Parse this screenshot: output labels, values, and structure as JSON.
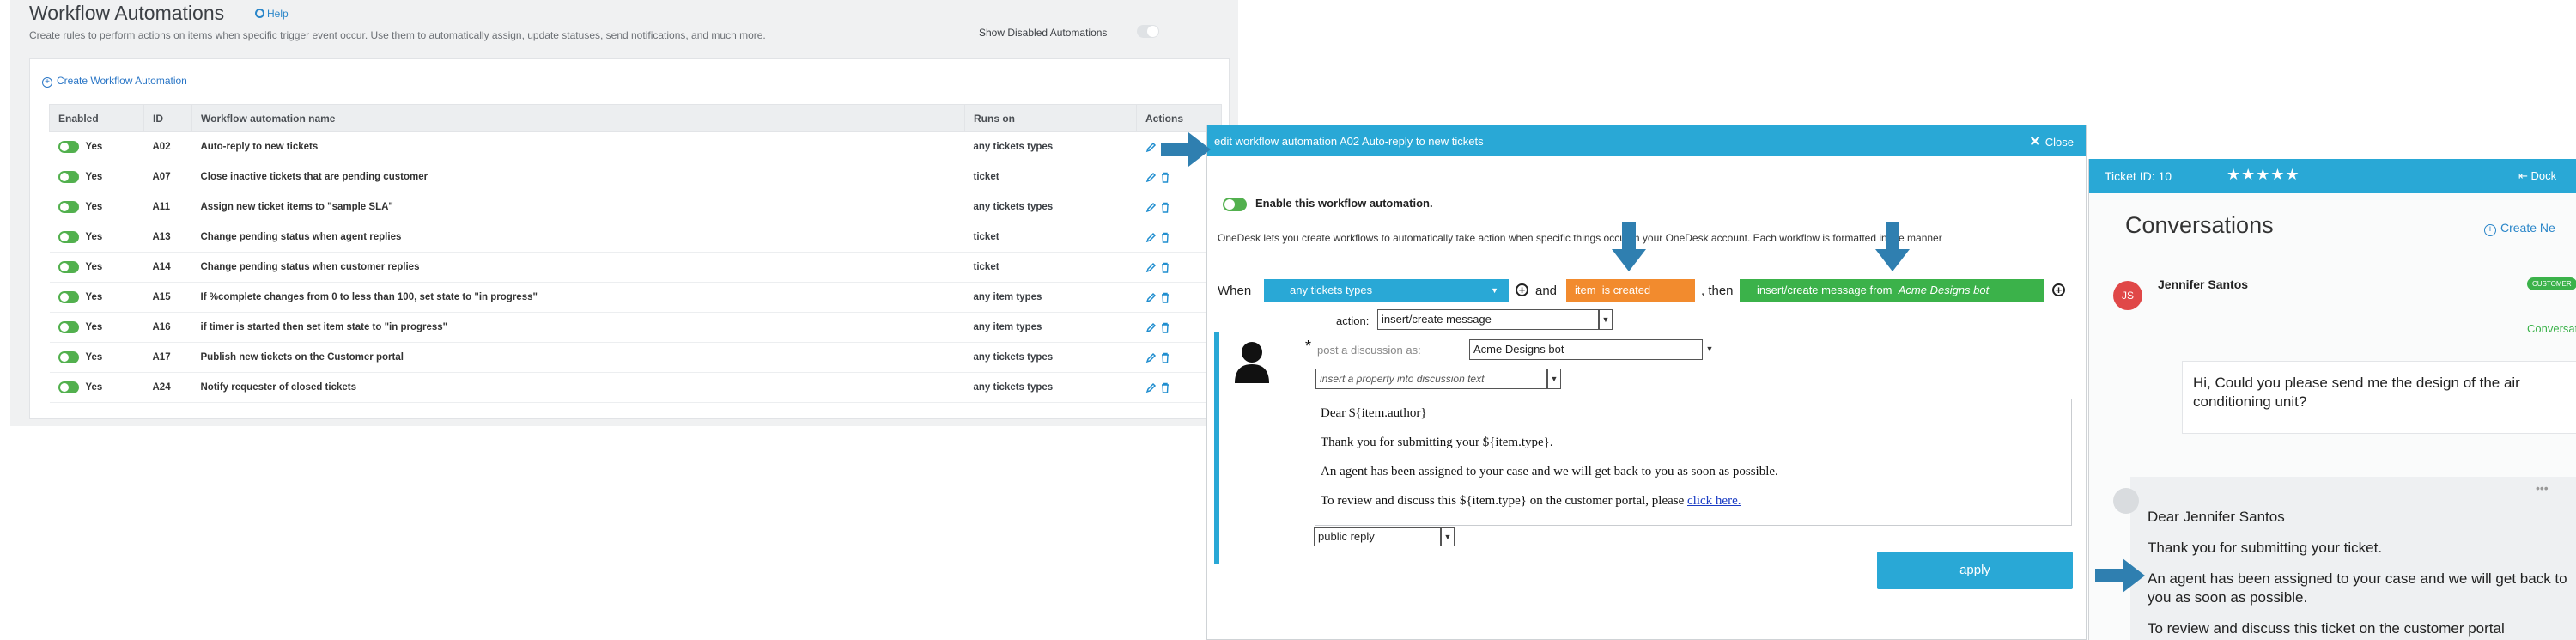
{
  "list": {
    "title": "Workflow Automations",
    "help": "Help",
    "subtitle": "Create rules to perform actions on items when specific trigger event occur. Use them to automatically assign, update statuses, send notifications, and much more.",
    "show_disabled": "Show Disabled Automations",
    "create": "Create Workflow Automation",
    "columns": [
      "Enabled",
      "ID",
      "Workflow automation name",
      "Runs on",
      "Actions"
    ],
    "rows": [
      {
        "enabled": "Yes",
        "id": "A02",
        "name": "Auto-reply to new tickets",
        "runs": "any tickets types"
      },
      {
        "enabled": "Yes",
        "id": "A07",
        "name": "Close inactive tickets that are pending customer",
        "runs": "ticket"
      },
      {
        "enabled": "Yes",
        "id": "A11",
        "name": "Assign new ticket items to \"sample SLA\"",
        "runs": "any tickets types"
      },
      {
        "enabled": "Yes",
        "id": "A13",
        "name": "Change pending status when agent replies",
        "runs": "ticket"
      },
      {
        "enabled": "Yes",
        "id": "A14",
        "name": "Change pending status when customer replies",
        "runs": "ticket"
      },
      {
        "enabled": "Yes",
        "id": "A15",
        "name": "If %complete changes from 0 to less than 100, set state to \"in progress\"",
        "runs": "any item types"
      },
      {
        "enabled": "Yes",
        "id": "A16",
        "name": "if timer is started then set item state to \"in progress\"",
        "runs": "any item types"
      },
      {
        "enabled": "Yes",
        "id": "A17",
        "name": "Publish new tickets on the Customer portal",
        "runs": "any tickets types"
      },
      {
        "enabled": "Yes",
        "id": "A24",
        "name": "Notify requester of closed tickets",
        "runs": "any tickets types"
      }
    ]
  },
  "dialog": {
    "title": "edit workflow automation A02 Auto-reply to new tickets",
    "close": "Close",
    "enable": "Enable this workflow automation.",
    "description": "OneDesk lets you create workflows to automatically take action when specific things occur in your OneDesk account. Each workflow is formatted in the manner",
    "when": "When",
    "trigger_type": "any tickets types",
    "and": "and",
    "event_item": "item",
    "event_text": "is created",
    "then": ", then",
    "action_pill_prefix": "insert/create message from",
    "action_pill_bot": "Acme Designs bot",
    "action_label": "action:",
    "action_value": "insert/create message",
    "post_as_label": "post a discussion as:",
    "post_as_value": "Acme Designs bot",
    "property_placeholder": "insert a property into discussion text",
    "message": {
      "p1": "Dear ${item.author}",
      "p2": "Thank you for submitting your ${item.type}.",
      "p3": "An agent has been assigned to your case and we will get back to you as soon as possible.",
      "p4": "To review and discuss this ${item.type} on the customer portal, please",
      "link": "click here."
    },
    "visibility": "public reply",
    "apply": "apply"
  },
  "ticket": {
    "id": "Ticket ID: 10",
    "stars": "★★★★★",
    "dock": "Dock",
    "heading": "Conversations",
    "create": "Create Ne",
    "initials": "JS",
    "name": "Jennifer Santos",
    "badge": "CUSTOMER",
    "conv_link": "Conversation",
    "customer_msg": "Hi, Could you please send me the design of the air conditioning unit?",
    "reply_p1": "Dear Jennifer Santos",
    "reply_p2": "Thank you for submitting your ticket.",
    "reply_p3": "An agent has been assigned to your case and we will get back to you as soon as possible.",
    "reply_p4": "To review and discuss this ticket on the customer portal"
  },
  "colors": {
    "accent": "#29a8d6",
    "toggle_on": "#52b04e",
    "orange": "#f28b2e",
    "green": "#3bb24a",
    "arrow": "#2f7fb0"
  }
}
